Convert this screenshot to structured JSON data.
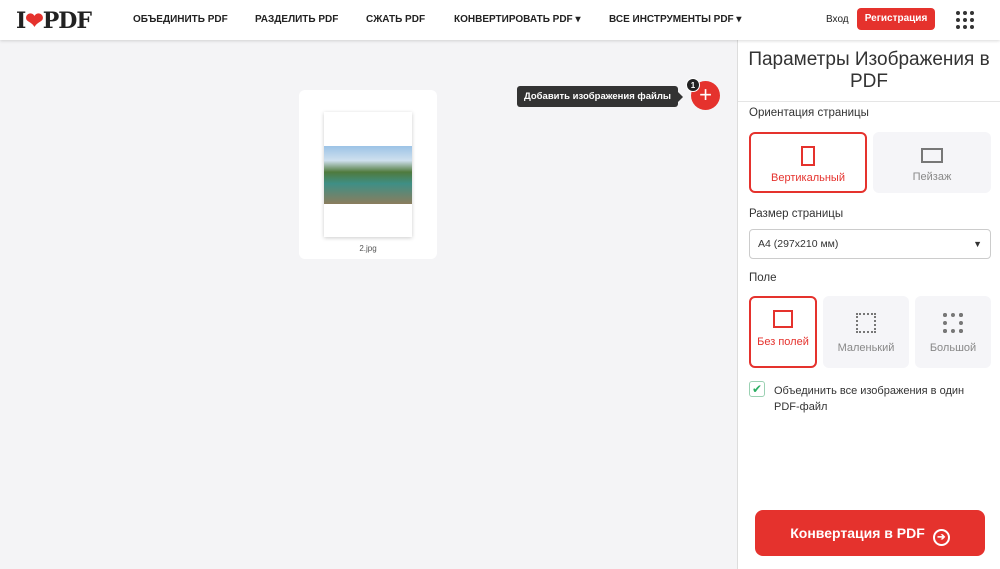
{
  "header": {
    "logo": "I❤PDF",
    "nav": [
      "ОБЪЕДИНИТЬ PDF",
      "РАЗДЕЛИТЬ PDF",
      "СЖАТЬ PDF",
      "КОНВЕРТИРОВАТЬ PDF ▾",
      "ВСЕ ИНСТРУМЕНТЫ PDF ▾"
    ],
    "login": "Вход",
    "register": "Регистрация"
  },
  "workspace": {
    "file_name": "2.jpg",
    "tooltip": "Добавить изображения файлы",
    "file_count": "1",
    "add": "+"
  },
  "sidebar": {
    "title": "Параметры Изображения в PDF",
    "orientation_label": "Ориентация страницы",
    "orientation": [
      "Вертикальный",
      "Пейзаж"
    ],
    "size_label": "Размер страницы",
    "size_value": "A4 (297x210 мм)",
    "margin_label": "Поле",
    "margins": [
      "Без полей",
      "Маленький",
      "Большой"
    ],
    "merge_label": "Объединить все изображения в один PDF-файл",
    "merge_checked": true,
    "convert": "Конвертация в PDF",
    "accent": "#e5322d"
  }
}
